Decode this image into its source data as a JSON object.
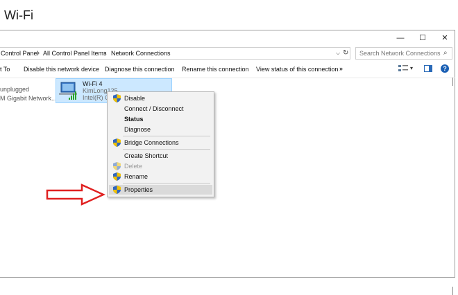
{
  "page_title": "Wi-Fi",
  "window": {
    "minimize_icon": "—",
    "maximize_icon": "☐",
    "close_icon": "✕"
  },
  "address": {
    "crumbs": [
      "Control Panel",
      "All Control Panel Items",
      "Network Connections"
    ],
    "separator": "›",
    "dropdown_icon": "⌵",
    "refresh_icon": "↻"
  },
  "search": {
    "placeholder": "Search Network Connections",
    "icon": "⌕"
  },
  "cmdbar": {
    "items": [
      "t To",
      "Disable this network device",
      "Diagnose this connection",
      "Rename this connection",
      "View status of this connection"
    ],
    "more": "»",
    "view_dropdown": "▾",
    "help": "?"
  },
  "adapters": {
    "left": {
      "status": "unplugged",
      "device": "M Gigabit Network..."
    },
    "wifi": {
      "name": "Wi-Fi 4",
      "network": "KimLong125",
      "device": "Intel(R) Ce"
    }
  },
  "context_menu": {
    "items": [
      {
        "label": "Disable",
        "shield": true,
        "bold": false,
        "disabled": false
      },
      {
        "label": "Connect / Disconnect",
        "shield": false,
        "bold": false,
        "disabled": false
      },
      {
        "label": "Status",
        "shield": false,
        "bold": true,
        "disabled": false
      },
      {
        "label": "Diagnose",
        "shield": false,
        "bold": false,
        "disabled": false
      },
      {
        "label": "Bridge Connections",
        "shield": true,
        "bold": false,
        "disabled": false
      },
      {
        "label": "Create Shortcut",
        "shield": false,
        "bold": false,
        "disabled": false
      },
      {
        "label": "Delete",
        "shield": true,
        "bold": false,
        "disabled": true
      },
      {
        "label": "Rename",
        "shield": true,
        "bold": false,
        "disabled": false
      },
      {
        "label": "Properties",
        "shield": true,
        "bold": false,
        "disabled": false,
        "highlighted": true
      }
    ]
  },
  "colors": {
    "selection": "#cce8ff",
    "arrow": "#e02020",
    "shield_blue": "#2f66c0",
    "shield_yellow": "#f2c200"
  }
}
